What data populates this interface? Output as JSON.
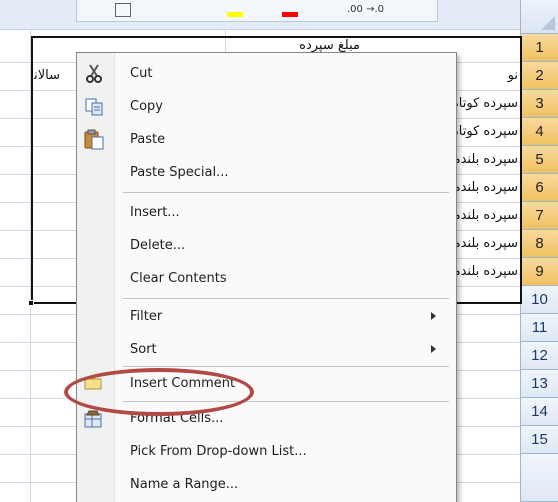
{
  "sheet": {
    "row_numbers": [
      "1",
      "2",
      "3",
      "4",
      "5",
      "6",
      "7",
      "8",
      "9",
      "10",
      "11",
      "12",
      "13",
      "14",
      "15"
    ],
    "selected_rows": [
      "1",
      "2",
      "3",
      "4",
      "5",
      "6",
      "7",
      "8",
      "9"
    ],
    "cells": {
      "row1_header": "مبلغ سپرده گذاری",
      "row2_left": "سالانه",
      "row2_right": "نو",
      "col_right": [
        "سپرده کوتاه",
        "سپرده کوتاه",
        "سپرده بلندمدت",
        "سپرده بلندمدت",
        "سپرده بلندمدت",
        "سپرده بلندمدت",
        "سپرده بلندمدت"
      ]
    }
  },
  "mini_toolbar": {
    "font_color": "#ff0000",
    "highlight_color": "#ffff00",
    "decimal_label": ".00 →.0"
  },
  "context_menu": {
    "items": [
      {
        "label": "Cut",
        "icon": "scissors-icon"
      },
      {
        "label": "Copy",
        "icon": "copy-icon"
      },
      {
        "label": "Paste",
        "icon": "paste-icon"
      },
      {
        "label": "Paste Special...",
        "icon": ""
      },
      {
        "label": "Insert...",
        "icon": ""
      },
      {
        "label": "Delete...",
        "icon": ""
      },
      {
        "label": "Clear Contents",
        "icon": ""
      },
      {
        "label": "Filter",
        "icon": "",
        "submenu": true
      },
      {
        "label": "Sort",
        "icon": "",
        "submenu": true
      },
      {
        "label": "Insert Comment",
        "icon": "comment-icon"
      },
      {
        "label": "Format Cells...",
        "icon": "format-cells-icon"
      },
      {
        "label": "Pick From Drop-down List...",
        "icon": ""
      },
      {
        "label": "Name a Range...",
        "icon": ""
      }
    ],
    "highlighted_item": "Format Cells...",
    "highlight_color": "#b14a44"
  }
}
